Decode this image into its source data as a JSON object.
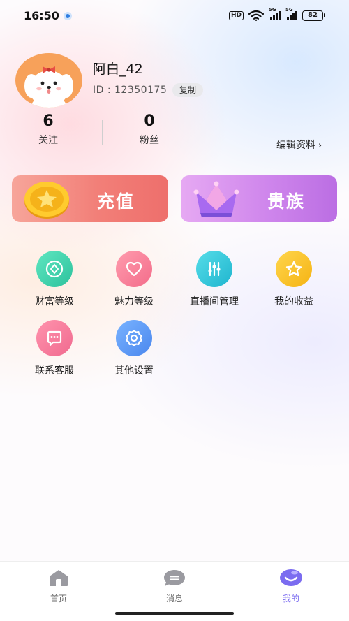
{
  "status_bar": {
    "time": "16:50",
    "hd_label": "HD",
    "sim1_label": "5G",
    "sim2_label": "5G",
    "battery": "82"
  },
  "profile": {
    "username": "阿白_42",
    "uid_label": "ID : 12350175",
    "copy_label": "复制",
    "following_count": "6",
    "following_label": "关注",
    "fans_count": "0",
    "fans_label": "粉丝",
    "edit_label": "编辑资料",
    "edit_chevron": "›"
  },
  "promo": {
    "recharge_label": "充值",
    "noble_label": "贵族"
  },
  "menu": {
    "items": [
      {
        "label": "财富等级",
        "icon": "coin-icon"
      },
      {
        "label": "魅力等级",
        "icon": "heart-icon"
      },
      {
        "label": "直播间管理",
        "icon": "sliders-icon"
      },
      {
        "label": "我的收益",
        "icon": "star-icon"
      },
      {
        "label": "联系客服",
        "icon": "chat-icon"
      },
      {
        "label": "其他设置",
        "icon": "gear-icon"
      }
    ]
  },
  "bottom_nav": {
    "home_label": "首页",
    "messages_label": "消息",
    "mine_label": "我的",
    "active_color": "#7b6cf0"
  }
}
